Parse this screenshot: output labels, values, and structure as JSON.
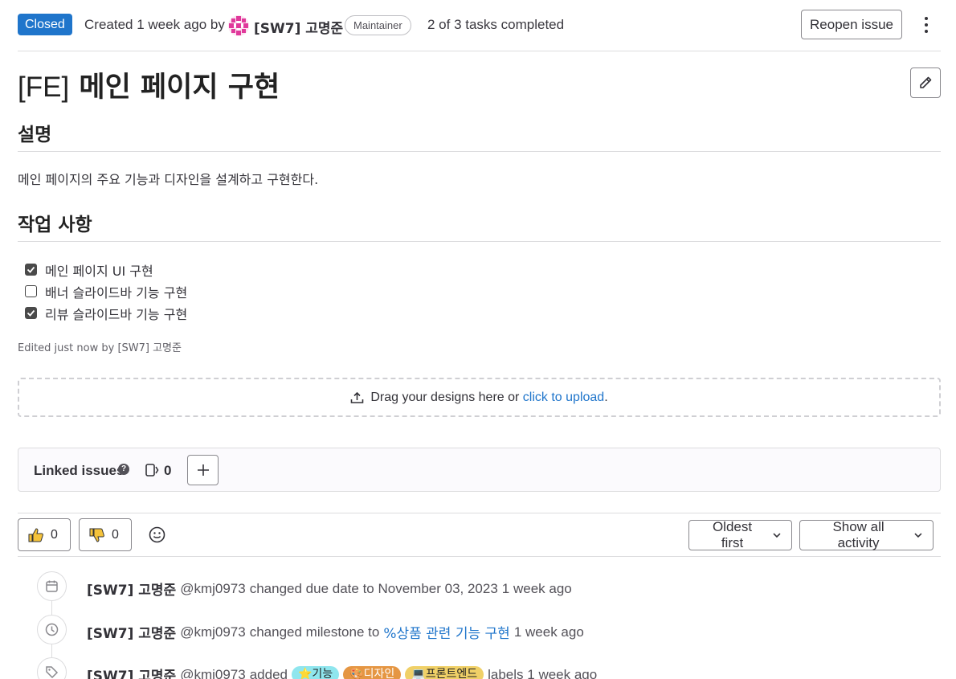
{
  "header": {
    "status": "Closed",
    "created_text": "Created 1 week ago by",
    "author": "[SW7] 고명준",
    "role": "Maintainer",
    "tasks_status": "2 of 3 tasks completed",
    "reopen_label": "Reopen issue"
  },
  "issue": {
    "title_prefix": "[FE]",
    "title_main": "메인 페이지 구현"
  },
  "description": {
    "heading": "설명",
    "text": "메인 페이지의 주요 기능과 디자인을 설계하고 구현한다.",
    "tasks_heading": "작업 사항",
    "tasks": [
      {
        "label": "메인 페이지 UI 구현",
        "checked": true
      },
      {
        "label": "배너 슬라이드바 기능 구현",
        "checked": false
      },
      {
        "label": "리뷰 슬라이드바 기능 구현",
        "checked": true
      }
    ],
    "edited": "Edited just now by [SW7] 고명준"
  },
  "upload": {
    "text": "Drag your designs here or",
    "link": "click to upload",
    "suffix": "."
  },
  "linked_issues": {
    "title": "Linked issues",
    "count": "0"
  },
  "reactions": {
    "thumbs_up": "0",
    "thumbs_down": "0"
  },
  "sort": {
    "order": "Oldest first",
    "filter": "Show all activity"
  },
  "activity": [
    {
      "author": "[SW7] 고명준",
      "handle": "@kmj0973",
      "text": "changed due date to November 03, 2023",
      "time": "1 week ago",
      "icon": "calendar-icon"
    },
    {
      "author": "[SW7] 고명준",
      "handle": "@kmj0973",
      "text": "changed milestone to",
      "link": "%상품 관련 기능 구현",
      "time": "1 week ago",
      "icon": "clock-icon"
    },
    {
      "author": "[SW7] 고명준",
      "handle": "@kmj0973",
      "text": "added",
      "labels": [
        {
          "text": "⭐기능",
          "color": "#8fe6ee"
        },
        {
          "text": "🎨디자인",
          "color": "#e59643"
        },
        {
          "text": "💻프론트엔드",
          "color": "#f0d067"
        }
      ],
      "suffix": "labels 1 week ago",
      "icon": "label-icon"
    }
  ]
}
